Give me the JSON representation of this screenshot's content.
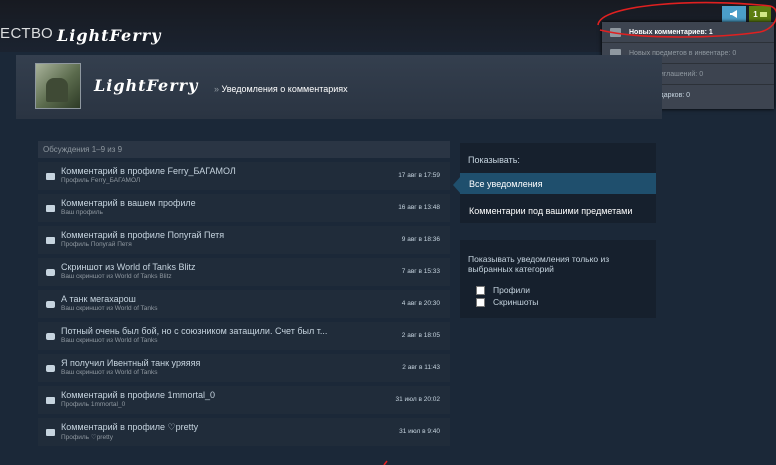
{
  "topbar": {
    "nav_text": "ЕСТВО",
    "username": "LightFerry",
    "notif_count": "1"
  },
  "notif_menu": [
    {
      "label": "Новых комментариев: 1",
      "icon": "comment-icon",
      "active": true
    },
    {
      "label": "Новых предметов в инвентаре: 0",
      "icon": "inventory-icon",
      "active": false
    },
    {
      "label": "Новых приглашений: 0",
      "icon": "invite-icon",
      "active": false
    },
    {
      "label": "Новых подарков: 0",
      "icon": "gift-icon",
      "active": false
    }
  ],
  "profile": {
    "name": "LightFerry",
    "separator": "»",
    "page_title": "Уведомления о комментариях"
  },
  "list": {
    "header": "Обсуждения 1–9 из 9",
    "rows": [
      {
        "title": "Комментарий в профиле Ferry_БАГАМОЛ",
        "sub": "Профиль Ferry_БАГАМОЛ",
        "date": "17 авг в 17:59",
        "icon": "comment-icon"
      },
      {
        "title": "Комментарий в вашем профиле",
        "sub": "Ваш профиль",
        "date": "16 авг в 13:48",
        "icon": "comment-icon"
      },
      {
        "title": "Комментарий в профиле Попугай Петя",
        "sub": "Профиль Попугай Петя",
        "date": "9 авг в 18:36",
        "icon": "comment-icon"
      },
      {
        "title": "Скриншот из World of Tanks Blitz",
        "sub": "Ваш скриншот из World of Tanks Blitz",
        "date": "7 авг в 15:33",
        "icon": "camera-icon"
      },
      {
        "title": "А танк мегахарош",
        "sub": "Ваш скриншот из World of Tanks",
        "date": "4 авг в 20:30",
        "icon": "camera-icon"
      },
      {
        "title": "Потный очень был бой, но с союзником затащили. Счет был т...",
        "sub": "Ваш скриншот из World of Tanks",
        "date": "2 авг в 18:05",
        "icon": "camera-icon"
      },
      {
        "title": "Я получил Ивентный танк уряяяя",
        "sub": "Ваш скриншот из World of Tanks",
        "date": "2 авг в 11:43",
        "icon": "camera-icon"
      },
      {
        "title": "Комментарий в профиле 1mmortal_0",
        "sub": "Профиль 1mmortal_0",
        "date": "31 июл в 20:02",
        "icon": "comment-icon"
      },
      {
        "title": "Комментарий в профиле ♡pretty",
        "sub": "Профиль ♡pretty",
        "date": "31 июл в 9:40",
        "icon": "comment-icon"
      }
    ]
  },
  "filter": {
    "heading": "Показывать:",
    "all_label": "Все уведомления",
    "items_label": "Комментарии под вашими предметами"
  },
  "categories": {
    "heading": "Показывать уведомления только из выбранных категорий",
    "profiles_label": "Профили",
    "screens_label": "Скриншоты"
  },
  "colors": {
    "background": "#1b2838",
    "accent_active": "#1f4f6d",
    "notif_green": "#5c7e10",
    "announce_blue": "#4b9ec9",
    "annotation_red": "#e02020"
  }
}
